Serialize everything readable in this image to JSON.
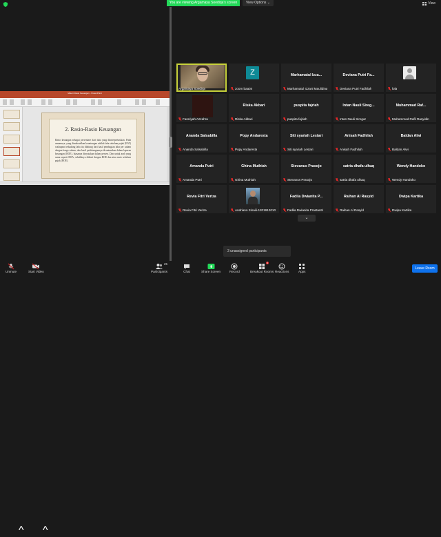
{
  "header": {
    "viewing_banner": "You are viewing Argamaya Soedirja's screen",
    "view_options": "View Options ⌄",
    "view_label": "View"
  },
  "shared_screen": {
    "window_title": "Materi Rasio Keuangan - PowerPoint",
    "slide_title": "2.  Rasio-Rasio Keuangan",
    "slide_text": "Rasio keuangan sebagai persentase dari data yang diinterpretasikan. Pada umumnya, yang dimaksudkan keuntungan adalah laba sebelum pajak (EAT) walaupun terkadang laba itu dihitung dari hasil pembagian laba per saham dengan harga saham, dan hasil perhitungannya dicantumkan dalam laporan keuangan (ROE), biasanya dinyatakan dalam persen. Dan untuk arah yang sama seperti ROA, sebaliknya diikuti dengan ROE dan atau rasio sebelum pajak (ROE)."
  },
  "participants": [
    {
      "display": "",
      "label": "Argamaya Soedirja",
      "kind": "video-face",
      "speaking": true,
      "muted": false
    },
    {
      "display": "",
      "label": "zoom baa04",
      "kind": "avatar-z",
      "avatar_letter": "Z",
      "muted": true
    },
    {
      "display": "Marhamatul  Izza...",
      "label": "Marhamatul Izzani Maulidina",
      "kind": "name",
      "muted": true
    },
    {
      "display": "Deviana Putri Fa...",
      "label": "Deviana Putri Fadhilah",
      "kind": "name",
      "muted": true
    },
    {
      "display": "",
      "label": "lola",
      "kind": "avatar-person",
      "muted": true
    },
    {
      "display": "",
      "label": "Fanniyah Azzahra",
      "kind": "video-dark",
      "muted": true
    },
    {
      "display": "Riska Akbari",
      "label": "Riska Akbari",
      "kind": "name",
      "muted": true
    },
    {
      "display": "puspita fajriah",
      "label": "puspita fajriah",
      "kind": "name",
      "muted": true
    },
    {
      "display": "Intan  Nauli Sireg...",
      "label": "Intan Nauli Siregar",
      "kind": "name",
      "muted": true
    },
    {
      "display": "Muhammad  Raf...",
      "label": "Muhammad Rafli Rasyidin",
      "kind": "name",
      "muted": true
    },
    {
      "display": "Ananda Salsabilla",
      "label": "Ananda Salsabilla",
      "kind": "name",
      "muted": true
    },
    {
      "display": "Popy Andaresta",
      "label": "Popy Andaresta",
      "kind": "name",
      "muted": true
    },
    {
      "display": "Siti syariah Lestari",
      "label": "Siti syariah Lestari",
      "kind": "name",
      "muted": true
    },
    {
      "display": "Anisah Fadhilah",
      "label": "Anisah Fadhilah",
      "kind": "name",
      "muted": true
    },
    {
      "display": "Baldan Alwi",
      "label": "Baldan Alwi",
      "kind": "name",
      "muted": true
    },
    {
      "display": "Amanda Putri",
      "label": "Amanda Putri",
      "kind": "name",
      "muted": true
    },
    {
      "display": "Ghina Muthiah",
      "label": "Ghina Muthiah",
      "kind": "name",
      "muted": true
    },
    {
      "display": "Stevanus Prasojo",
      "label": "Stevanus Prasojo",
      "kind": "name",
      "muted": true
    },
    {
      "display": "satria dhafa ulhaq",
      "label": "satria dhafa ulhaq",
      "kind": "name",
      "muted": true
    },
    {
      "display": "Wendy Handoko",
      "label": "Wendy Handoko",
      "kind": "name",
      "muted": true
    },
    {
      "display": "Revia Fitri Veriza",
      "label": "Revia Fitri Veriza",
      "kind": "name",
      "muted": true
    },
    {
      "display": "",
      "label": "Andriano Sinaili-1201912010",
      "kind": "avatar-photo",
      "muted": true
    },
    {
      "display": "Fadila Dwianita P...",
      "label": "Fadila Dwianita Prastantri",
      "kind": "name",
      "muted": true
    },
    {
      "display": "Raihan Al Rasyid",
      "label": "Raihan Al Rasyid",
      "kind": "name",
      "muted": true
    },
    {
      "display": "Dwipa Kartika",
      "label": "Dwipa Kartika",
      "kind": "name",
      "muted": true
    }
  ],
  "more_button": "⌄",
  "unassigned_text": "3 unassigned participants",
  "toolbar": {
    "unmute": "Unmute",
    "start_video": "Start Video",
    "participants": "Participants",
    "participants_count": "25",
    "chat": "Chat",
    "share_screen": "Share Screen",
    "record": "Record",
    "breakout_rooms": "Breakout Rooms",
    "breakout_badge": "6",
    "reactions": "Reactions",
    "apps": "Apps",
    "leave_room": "Leave Room"
  },
  "colors": {
    "banner_green": "#23d959",
    "speaker_outline": "#c8d23a",
    "muted_red": "#e02828",
    "leave_blue": "#0e72ed"
  }
}
